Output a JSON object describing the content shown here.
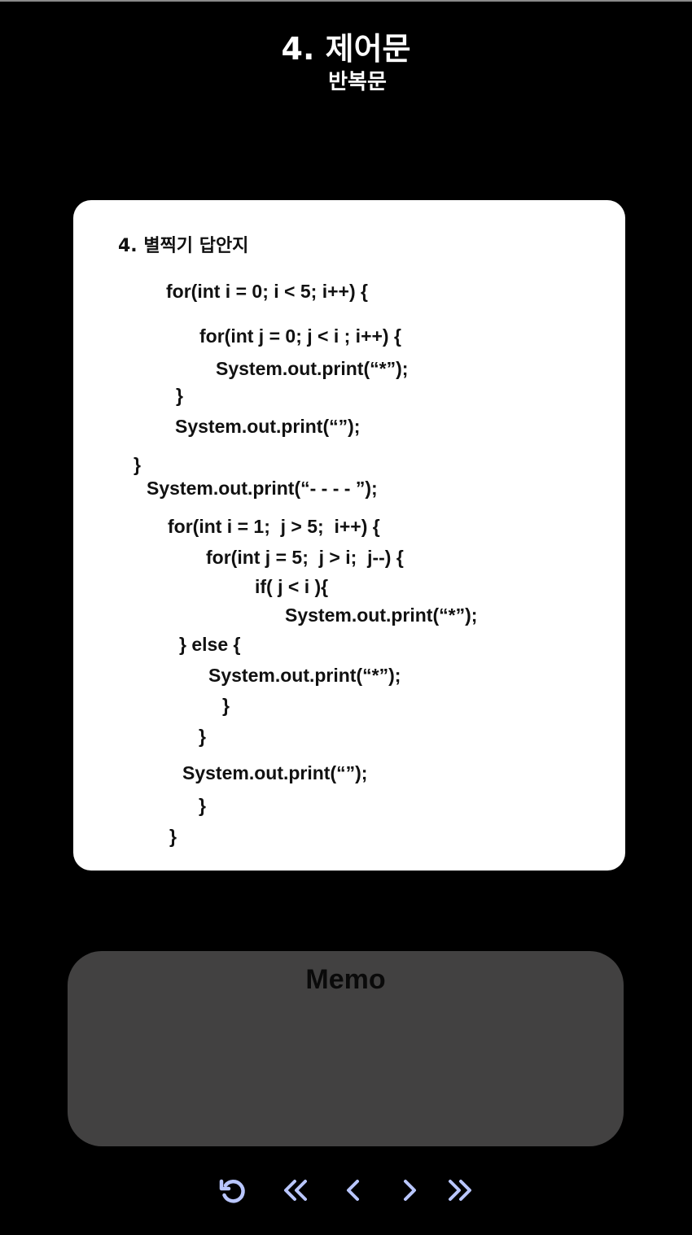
{
  "header": {
    "title": "4. 제어문",
    "subtitle": "반복문"
  },
  "card": {
    "title": "4. 별찍기 답안지",
    "code_lines": [
      "for(int i = 0; i < 5; i++) {",
      "for(int j = 0; j < i ; i++) {",
      "System.out.print(“*”);",
      "}",
      "System.out.print(“”);",
      "}",
      "System.out.print(“- - - - ”);",
      "for(int i = 1;  j > 5;  i++) {",
      "for(int j = 5;  j > i;  j--) {",
      "if( j < i ){",
      "System.out.print(“*”);",
      "} else {",
      "System.out.print(“*”);",
      "}",
      "}",
      "System.out.print(“”);",
      "}",
      "}"
    ]
  },
  "memo": {
    "title": "Memo"
  },
  "nav": {
    "accent_color": "#b9c6ff",
    "icons": [
      "refresh-icon",
      "double-chevron-left-icon",
      "chevron-left-icon",
      "chevron-right-icon",
      "double-chevron-right-icon"
    ]
  }
}
